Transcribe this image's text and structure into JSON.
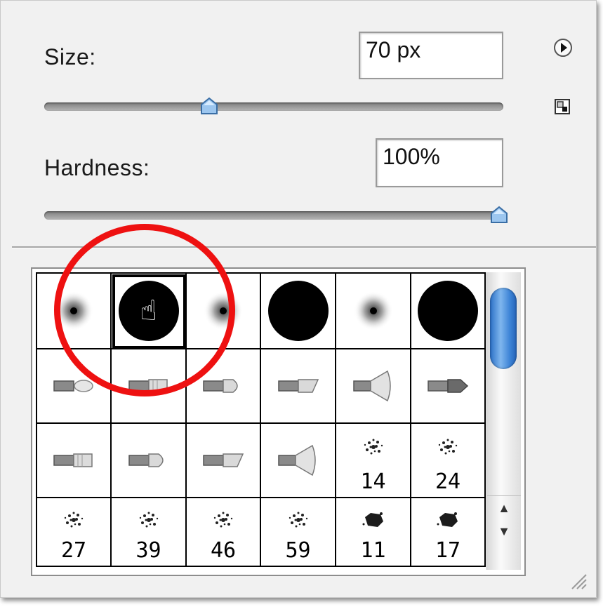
{
  "size": {
    "label": "Size:",
    "value": "70 px",
    "slider_fraction": 0.36
  },
  "hardness": {
    "label": "Hardness:",
    "value": "100%",
    "slider_fraction": 1.0
  },
  "icons": {
    "flyout_menu": "flyout-menu-arrow-icon",
    "new_preset": "new-preset-icon",
    "resize": "resize-grip-icon"
  },
  "colors": {
    "accent": "#3c83d6",
    "highlight_ring": "#ee1111"
  },
  "brush_presets": [
    {
      "row": 1,
      "kind": "soft-round",
      "number": ""
    },
    {
      "row": 1,
      "kind": "hard-round",
      "number": "",
      "selected": true
    },
    {
      "row": 1,
      "kind": "soft-round",
      "number": ""
    },
    {
      "row": 1,
      "kind": "hard-round",
      "number": ""
    },
    {
      "row": 1,
      "kind": "soft-round",
      "number": ""
    },
    {
      "row": 1,
      "kind": "hard-round",
      "number": ""
    },
    {
      "row": 2,
      "kind": "bristle-round",
      "number": ""
    },
    {
      "row": 2,
      "kind": "bristle-flat",
      "number": ""
    },
    {
      "row": 2,
      "kind": "bristle-point",
      "number": ""
    },
    {
      "row": 2,
      "kind": "bristle-angle",
      "number": ""
    },
    {
      "row": 2,
      "kind": "bristle-fan",
      "number": ""
    },
    {
      "row": 2,
      "kind": "bristle-blunt",
      "number": ""
    },
    {
      "row": 3,
      "kind": "bristle-flat",
      "number": ""
    },
    {
      "row": 3,
      "kind": "bristle-point",
      "number": ""
    },
    {
      "row": 3,
      "kind": "bristle-angle",
      "number": ""
    },
    {
      "row": 3,
      "kind": "bristle-fan",
      "number": ""
    },
    {
      "row": 3,
      "kind": "spatter",
      "number": "14"
    },
    {
      "row": 3,
      "kind": "spatter",
      "number": "24"
    },
    {
      "row": 4,
      "kind": "spatter",
      "number": "27"
    },
    {
      "row": 4,
      "kind": "spatter",
      "number": "39"
    },
    {
      "row": 4,
      "kind": "spatter",
      "number": "46"
    },
    {
      "row": 4,
      "kind": "spatter",
      "number": "59"
    },
    {
      "row": 4,
      "kind": "chalk",
      "number": "11"
    },
    {
      "row": 4,
      "kind": "chalk",
      "number": "17"
    }
  ],
  "scrollbar": {
    "up_arrow": "▲",
    "down_arrow": "▼"
  }
}
